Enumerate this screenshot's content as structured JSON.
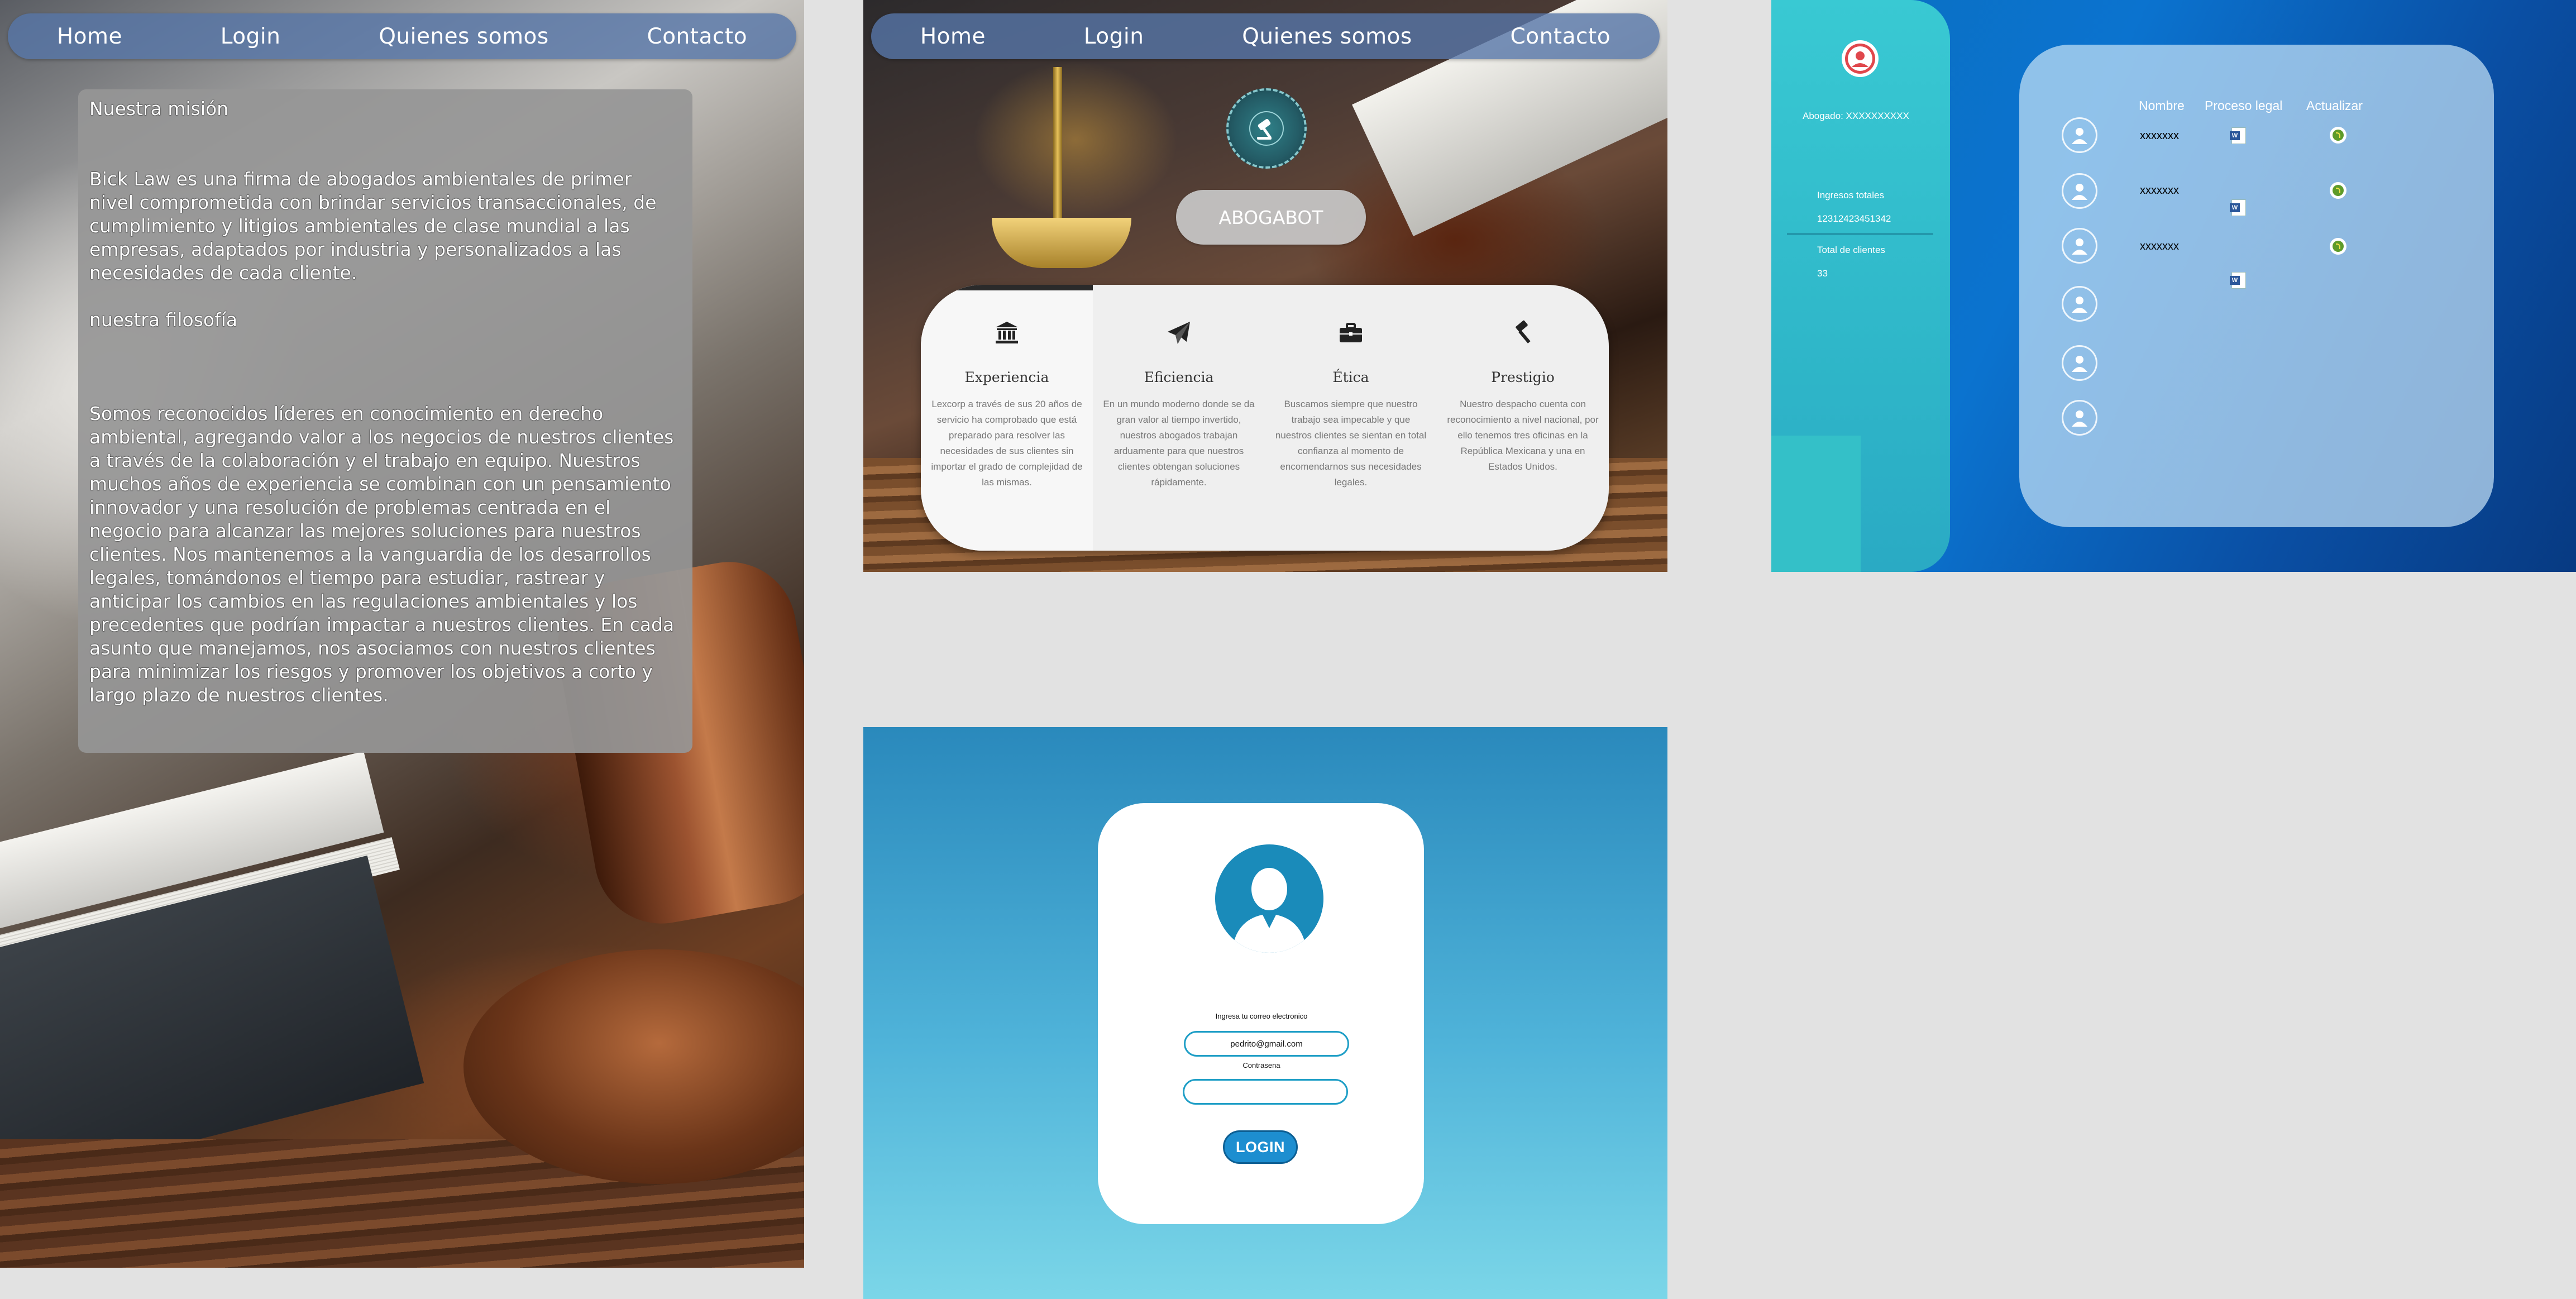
{
  "nav_items": [
    "Home",
    "Login",
    "Quienes somos",
    "Contacto"
  ],
  "mission": {
    "heading": "Nuestra misión",
    "paragraph1": "Bick Law es una firma de abogados ambientales de primer nivel comprometida con brindar servicios transaccionales, de cumplimiento y litigios ambientales de clase mundial a las empresas, adaptados por industria y personalizados a las necesidades de cada cliente.",
    "philosophy_heading": "nuestra filosofía",
    "paragraph2": "Somos reconocidos líderes en conocimiento en derecho ambiental, agregando valor a los negocios de nuestros clientes a través de la colaboración y el trabajo en equipo. Nuestros muchos años de experiencia se combinan con un pensamiento innovador y una resolución de problemas centrada en el negocio para alcanzar las mejores soluciones para nuestros clientes. Nos mantenemos a la vanguardia de los desarrollos legales, tomándonos el tiempo para estudiar, rastrear y anticipar los cambios en las regulaciones ambientales y los precedentes que podrían impactar a nuestros clientes. En cada asunto que manejamos, nos asociamos con nuestros clientes para minimizar los riesgos y promover los objetivos a corto y largo plazo de nuestros clientes."
  },
  "services_page": {
    "brand_button": "ABOGABOT",
    "services": [
      {
        "icon": "bank-icon",
        "title": "Experiencia",
        "description": "Lexcorp a través de sus 20 años de servicio ha comprobado que está preparado para resolver las necesidades de sus clientes sin importar el grado de complejidad de las mismas."
      },
      {
        "icon": "paper-plane-icon",
        "title": "Eficiencia",
        "description": "En un mundo moderno donde se da gran valor al tiempo invertido, nuestros abogados trabajan arduamente para que nuestros clientes obtengan soluciones rápidamente."
      },
      {
        "icon": "briefcase-icon",
        "title": "Ética",
        "description": "Buscamos siempre que nuestro trabajo sea impecable y que nuestros clientes se sientan en total confianza al momento de encomendarnos sus necesidades legales."
      },
      {
        "icon": "gavel-icon",
        "title": "Prestigio",
        "description": "Nuestro despacho cuenta con reconocimiento a nivel nacional, por ello tenemos tres oficinas en la República Mexicana y una en Estados Unidos."
      }
    ]
  },
  "dashboard": {
    "lawyer_label": "Abogado: XXXXXXXXXX",
    "income_label": "Ingresos totales",
    "income_value": "12312423451342",
    "clients_label": "Total de clientes",
    "clients_value": "33",
    "columns": [
      "Nombre",
      "Proceso legal",
      "Actualizar"
    ],
    "rows": [
      {
        "name": "xxxxxxx"
      },
      {
        "name": "xxxxxxx"
      },
      {
        "name": "xxxxxxx"
      },
      {
        "name": ""
      },
      {
        "name": ""
      },
      {
        "name": ""
      }
    ]
  },
  "login": {
    "email_label": "Ingresa tu correo electronico",
    "email_value": "pedrito@gmail.com",
    "password_label": "Contrasena",
    "password_value": "",
    "button": "LOGIN"
  },
  "colors": {
    "nav_bg": "#5676a8",
    "dashboard_side": "#39c9d3",
    "dashboard_bg": "#0a6fc0",
    "login_button": "#1d8ed0",
    "login_accent": "#1a8bba"
  }
}
